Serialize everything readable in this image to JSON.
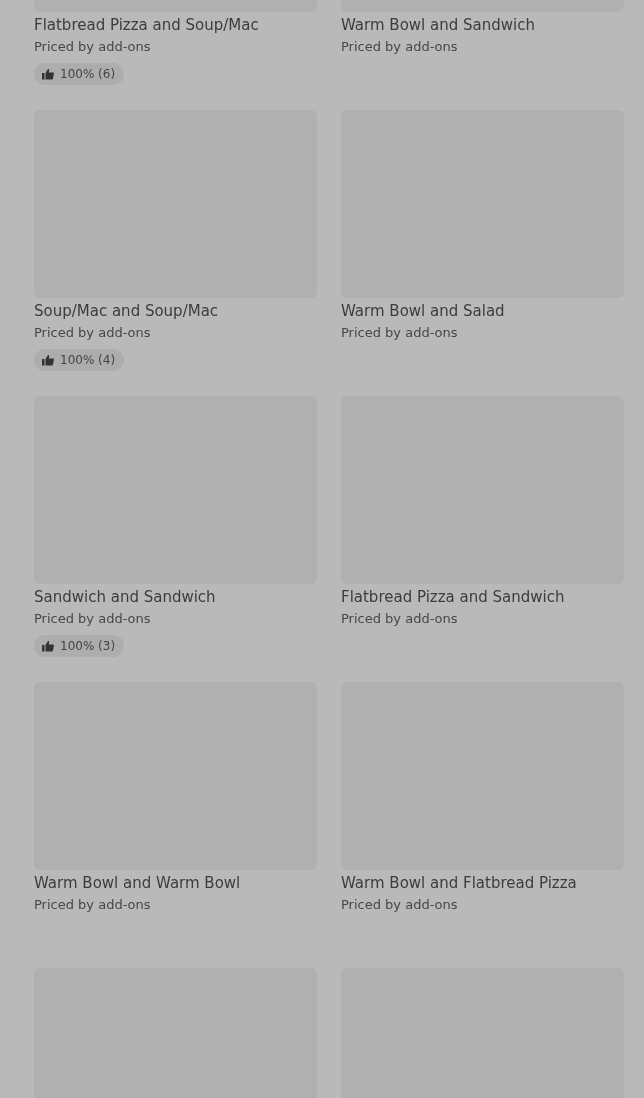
{
  "items": [
    {
      "kind": "dish",
      "title": "Flatbread Pizza and Soup/Mac",
      "subtitle": "Priced by add-ons",
      "rating": "100% (6)"
    },
    {
      "kind": "dish",
      "title": "Warm Bowl and Sandwich",
      "subtitle": "Priced by add-ons"
    },
    {
      "kind": "dish",
      "title": "Soup/Mac and Soup/Mac",
      "subtitle": "Priced by add-ons",
      "rating": "100% (4)"
    },
    {
      "kind": "dish",
      "title": "Warm Bowl and Salad",
      "subtitle": "Priced by add-ons"
    },
    {
      "kind": "dish",
      "title": "Sandwich and Sandwich",
      "subtitle": "Priced by add-ons",
      "rating": "100% (3)"
    },
    {
      "kind": "dish",
      "title": "Flatbread Pizza and Sandwich",
      "subtitle": "Priced by add-ons"
    },
    {
      "kind": "dish",
      "title": "Warm Bowl and Warm Bowl",
      "subtitle": "Priced by add-ons"
    },
    {
      "kind": "dish",
      "title": "Warm Bowl and Flatbread Pizza",
      "subtitle": "Priced by add-ons"
    },
    {
      "kind": "loading"
    },
    {
      "kind": "loading"
    }
  ]
}
